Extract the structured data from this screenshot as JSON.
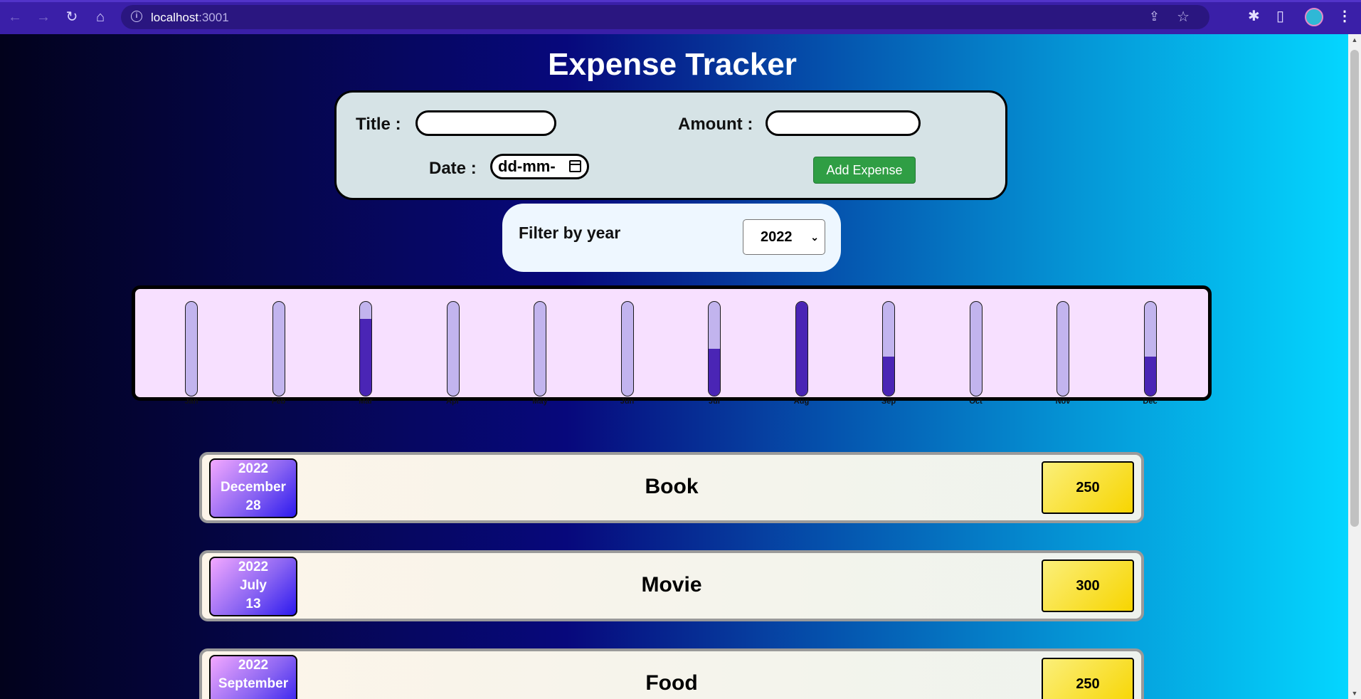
{
  "browser": {
    "url_host": "localhost",
    "url_port": ":3001"
  },
  "app": {
    "title": "Expense Tracker"
  },
  "form": {
    "title_label": "Title :",
    "title_value": "",
    "amount_label": "Amount :",
    "amount_value": "",
    "date_label": "Date :",
    "date_placeholder": "dd-mm-",
    "add_button": "Add Expense"
  },
  "filter": {
    "label": "Filter by year",
    "selected_year": "2022"
  },
  "chart_data": {
    "type": "bar",
    "categories": [
      "Jan",
      "Feb",
      "Mar",
      "Apr",
      "May",
      "Jun",
      "Jul",
      "Aug",
      "Sep",
      "Oct",
      "Nov",
      "Dec"
    ],
    "values": [
      0,
      0,
      0.82,
      0,
      0,
      0,
      0.5,
      1.0,
      0.42,
      0,
      0,
      0.42
    ],
    "ylim": [
      0,
      1
    ]
  },
  "expenses": [
    {
      "year": "2022",
      "month": "December",
      "day": "28",
      "title": "Book",
      "amount": "250"
    },
    {
      "year": "2022",
      "month": "July",
      "day": "13",
      "title": "Movie",
      "amount": "300"
    },
    {
      "year": "2022",
      "month": "September",
      "day": "",
      "title": "Food",
      "amount": "250"
    }
  ],
  "colors": {
    "bar_fill": "#4a25b5",
    "bar_track": "#c2b4ee",
    "add_button": "#2f9e44",
    "chart_bg": "#f7e0ff"
  }
}
